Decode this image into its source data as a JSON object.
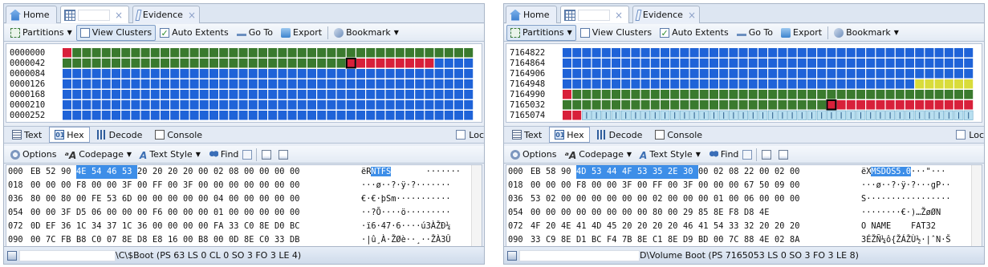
{
  "panes": [
    {
      "tabs": [
        {
          "label": "Home",
          "icon": "home-icon"
        },
        {
          "label": "",
          "icon": "grid-icon",
          "closable": true,
          "active": true
        },
        {
          "label": "Evidence",
          "icon": "evidence-icon",
          "closable": true
        }
      ],
      "toolbar": {
        "partitions": "Partitions",
        "view_clusters": "View Clusters",
        "auto_extents": "Auto Extents",
        "go_to": "Go To",
        "export": "Export",
        "bookmark": "Bookmark"
      },
      "clusters": {
        "rows": [
          "0000000",
          "0000042",
          "0000084",
          "0000126",
          "0000168",
          "0000210",
          "0000252"
        ],
        "row_codes": [
          "rggggggggggggggggggggggggggggggggggggggggg",
          "gggggggggggggggggggggggggggggKrrrrrrrrbbbbbbbbbbbbb",
          "bbbbbbbbbbbbbbbbbbbbbbbbbbbbbbbbbbbbbbbbbb",
          "bbbbbbbbbbbbbbbbbbbbbbbbbbbbbbbbbbbbbbbbbb",
          "bbbbbbbbbbbbbbbbbbbbbbbbbbbbbbbbbbbbbbbbbb",
          "bbbbbbbbbbbbbbbbbbbbbbbbbbbbbbbbbbbbbbbbbb",
          "bbbbbbbbbbbbbbbbbbbbbbbbbbbbbbbbbbbbbbbbbb"
        ]
      },
      "view_tabs": {
        "text": "Text",
        "hex": "Hex",
        "decode": "Decode",
        "console": "Console",
        "lock": "Loc"
      },
      "toolbar2": {
        "options": "Options",
        "codepage": "Codepage",
        "text_style": "Text Style",
        "find": "Find"
      },
      "hex": [
        {
          "off": "000",
          "bytes": [
            "EB",
            "52",
            "90",
            "4E",
            "54",
            "46",
            "53",
            "20",
            "20",
            "20",
            "20",
            "00",
            "02",
            "08",
            "00",
            "00",
            "00",
            "00"
          ],
          "sel": [
            3,
            4,
            5,
            6
          ],
          "ascii_pre": "ëR",
          "ascii_sel": "NTFS",
          "ascii_post": "       ·······"
        },
        {
          "off": "018",
          "bytes": [
            "00",
            "00",
            "00",
            "F8",
            "00",
            "00",
            "3F",
            "00",
            "FF",
            "00",
            "3F",
            "00",
            "00",
            "00",
            "00",
            "00",
            "00",
            "00"
          ],
          "sel": [],
          "ascii_pre": "···ø··?·ÿ·?·······",
          "ascii_sel": "",
          "ascii_post": ""
        },
        {
          "off": "036",
          "bytes": [
            "80",
            "00",
            "80",
            "00",
            "FE",
            "53",
            "6D",
            "00",
            "00",
            "00",
            "00",
            "00",
            "04",
            "00",
            "00",
            "00",
            "00",
            "00"
          ],
          "sel": [],
          "ascii_pre": "€·€·þSm···········",
          "ascii_sel": "",
          "ascii_post": ""
        },
        {
          "off": "054",
          "bytes": [
            "00",
            "00",
            "3F",
            "D5",
            "06",
            "00",
            "00",
            "00",
            "F6",
            "00",
            "00",
            "00",
            "01",
            "00",
            "00",
            "00",
            "00",
            "00"
          ],
          "sel": [],
          "ascii_pre": "··?Õ····ö·········",
          "ascii_sel": "",
          "ascii_post": ""
        },
        {
          "off": "072",
          "bytes": [
            "0D",
            "EF",
            "36",
            "1C",
            "34",
            "37",
            "1C",
            "36",
            "00",
            "00",
            "00",
            "00",
            "FA",
            "33",
            "C0",
            "8E",
            "D0",
            "BC"
          ],
          "sel": [],
          "ascii_pre": "·ï6·47·6····ú3ÀŽÐ¼",
          "ascii_sel": "",
          "ascii_post": ""
        },
        {
          "off": "090",
          "bytes": [
            "00",
            "7C",
            "FB",
            "B8",
            "C0",
            "07",
            "8E",
            "D8",
            "E8",
            "16",
            "00",
            "B8",
            "00",
            "0D",
            "8E",
            "C0",
            "33",
            "DB"
          ],
          "sel": [],
          "ascii_pre": "·|û¸À·ŽØè··¸··ŽÀ3Û",
          "ascii_sel": "",
          "ascii_post": ""
        }
      ],
      "status": {
        "path": "\\C\\$Boot (PS 63  LS 0  CL 0  SO 3  FO 3  LE 4)"
      }
    },
    {
      "tabs": [
        {
          "label": "Home",
          "icon": "home-icon"
        },
        {
          "label": "",
          "icon": "grid-icon",
          "closable": true,
          "active": true
        },
        {
          "label": "Evidence",
          "icon": "evidence-icon",
          "closable": true
        }
      ],
      "toolbar": {
        "partitions": "Partitions",
        "view_clusters": "View Clusters",
        "auto_extents": "Auto Extents",
        "go_to": "Go To",
        "export": "Export",
        "bookmark": "Bookmark"
      },
      "clusters": {
        "rows": [
          "7164822",
          "7164864",
          "7164906",
          "7164948",
          "7164990",
          "7165032",
          "7165074"
        ],
        "row_codes": [
          "bbbbbbbbbbbbbbbbbbbbbbbbbbbbbbbbbbbbbbbbbb",
          "bbbbbbbbbbbbbbbbbbbbbbbbbbbbbbbbbbbbbbbbbb",
          "bbbbbbbbbbbbbbbbbbbbbbbbbbbbbbbbbbbbbbbbbb",
          "bbbbbbbbbbbbbbbbbbbbbbbbbbbbbbbbbbbbyyyyyy",
          "rggggggggggggggggggggggggggggggggggggggggg",
          "gggggggggggggggggggggggggggKrrrrrrrrrrrrrrr",
          "rrtttttttttttttttttttttttttttttttttttttttt"
        ]
      },
      "view_tabs": {
        "text": "Text",
        "hex": "Hex",
        "decode": "Decode",
        "console": "Console",
        "lock": "Loc"
      },
      "toolbar2": {
        "options": "Options",
        "codepage": "Codepage",
        "text_style": "Text Style",
        "find": "Find"
      },
      "hex": [
        {
          "off": "000",
          "bytes": [
            "EB",
            "58",
            "90",
            "4D",
            "53",
            "44",
            "4F",
            "53",
            "35",
            "2E",
            "30",
            "00",
            "02",
            "08",
            "22",
            "00",
            "02",
            "00"
          ],
          "sel": [
            3,
            4,
            5,
            6,
            7,
            8,
            9,
            10
          ],
          "ascii_pre": "ëX",
          "ascii_sel": "MSDOS5.0",
          "ascii_post": "···\"···"
        },
        {
          "off": "018",
          "bytes": [
            "00",
            "00",
            "00",
            "F8",
            "00",
            "00",
            "3F",
            "00",
            "FF",
            "00",
            "3F",
            "00",
            "00",
            "00",
            "67",
            "50",
            "09",
            "00"
          ],
          "sel": [],
          "ascii_pre": "···ø··?·ÿ·?···gP··",
          "ascii_sel": "",
          "ascii_post": ""
        },
        {
          "off": "036",
          "bytes": [
            "53",
            "02",
            "00",
            "00",
            "00",
            "00",
            "00",
            "00",
            "02",
            "00",
            "00",
            "00",
            "01",
            "00",
            "06",
            "00",
            "00",
            "00"
          ],
          "sel": [],
          "ascii_pre": "S·················",
          "ascii_sel": "",
          "ascii_post": ""
        },
        {
          "off": "054",
          "bytes": [
            "00",
            "00",
            "00",
            "00",
            "00",
            "00",
            "00",
            "00",
            "80",
            "00",
            "29",
            "85",
            "8E",
            "F8",
            "D8",
            "4E"
          ],
          "sel": [],
          "ascii_pre": "········€·)…ŽøØN",
          "ascii_sel": "",
          "ascii_post": ""
        },
        {
          "off": "072",
          "bytes": [
            "4F",
            "20",
            "4E",
            "41",
            "4D",
            "45",
            "20",
            "20",
            "20",
            "20",
            "46",
            "41",
            "54",
            "33",
            "32",
            "20",
            "20",
            "20"
          ],
          "sel": [],
          "ascii_pre": "O NAME    FAT32",
          "ascii_sel": "",
          "ascii_post": ""
        },
        {
          "off": "090",
          "bytes": [
            "33",
            "C9",
            "8E",
            "D1",
            "BC",
            "F4",
            "7B",
            "8E",
            "C1",
            "8E",
            "D9",
            "BD",
            "00",
            "7C",
            "88",
            "4E",
            "02",
            "8A"
          ],
          "sel": [],
          "ascii_pre": "3ÉŽÑ¼ô{ŽÁŽÙ½·|ˆN·Š",
          "ascii_sel": "",
          "ascii_post": ""
        }
      ],
      "status": {
        "path": "D\\Volume Boot (PS 7165053  LS 0  SO 3  FO 3  LE 8)"
      }
    }
  ],
  "colors": {
    "used": "#1f63d8",
    "free": "#3a7a2e",
    "selected": "#d8203a",
    "cursor": "#111111",
    "yellow": "#d9dc3a",
    "tick": "#b9dff0",
    "grid_border": "#ffffff"
  }
}
